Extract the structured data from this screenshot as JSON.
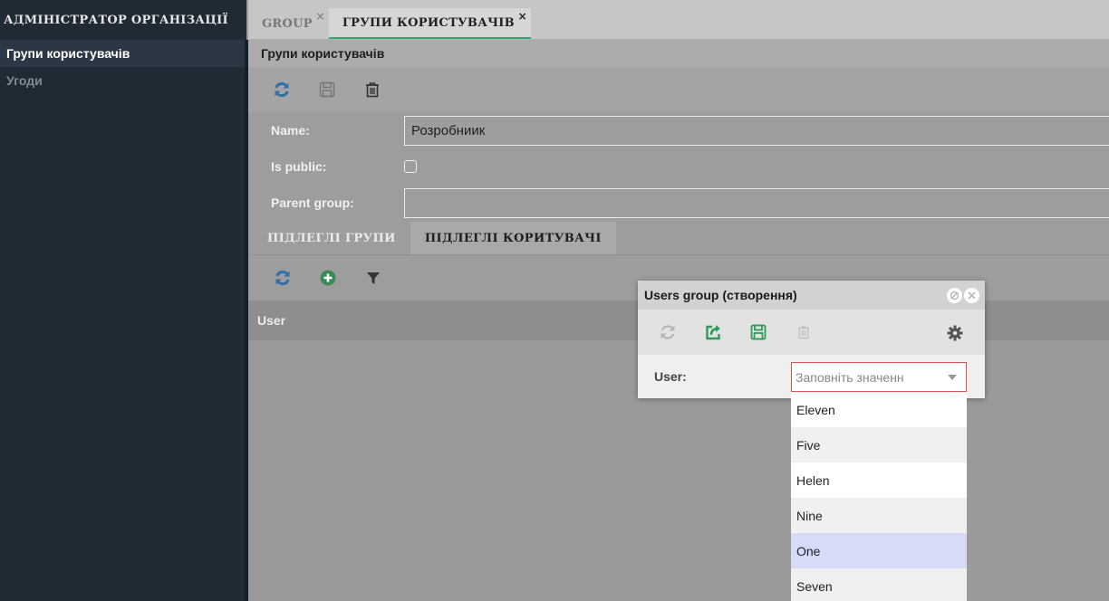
{
  "sidebar": {
    "header": "АДМІНІСТРАТОР ОРГАНІЗАЦІЇ",
    "items": [
      {
        "label": "Групи користувачів",
        "active": true
      },
      {
        "label": "Угоди",
        "active": false
      }
    ]
  },
  "tabs": [
    {
      "label": "GROUP",
      "close": "×",
      "active": false
    },
    {
      "label": "ГРУПИ КОРИСТУВАЧІВ",
      "close": "×",
      "active": true
    }
  ],
  "section": {
    "title": "Групи користувачів"
  },
  "toolbar": {
    "icons": [
      "refresh-icon",
      "save-icon",
      "delete-icon"
    ]
  },
  "form": {
    "name_label": "Name:",
    "name_value": "Розробниик",
    "is_public_label": "Is public:",
    "parent_group_label": "Parent group:",
    "parent_group_value": ""
  },
  "subtabs": [
    {
      "label": "ПІДЛЕГЛІ ГРУПИ",
      "active": false
    },
    {
      "label": "ПІДЛЕГЛІ КОРИТУВАЧІ",
      "active": true
    }
  ],
  "grid": {
    "column_user": "User"
  },
  "dialog": {
    "title": "Users group (створення)",
    "user_label": "User:",
    "user_placeholder": "Заповніть значенн"
  },
  "dropdown": {
    "options": [
      "Eleven",
      "Five",
      "Helen",
      "Nine",
      "One",
      "Seven"
    ],
    "highlighted": "One"
  },
  "colors": {
    "sidebar_bg": "#1f2a35",
    "accent_green": "#3aa572",
    "icon_blue": "#2f6fa8",
    "error_red": "#d9534f",
    "highlight": "#d6dcf8"
  }
}
